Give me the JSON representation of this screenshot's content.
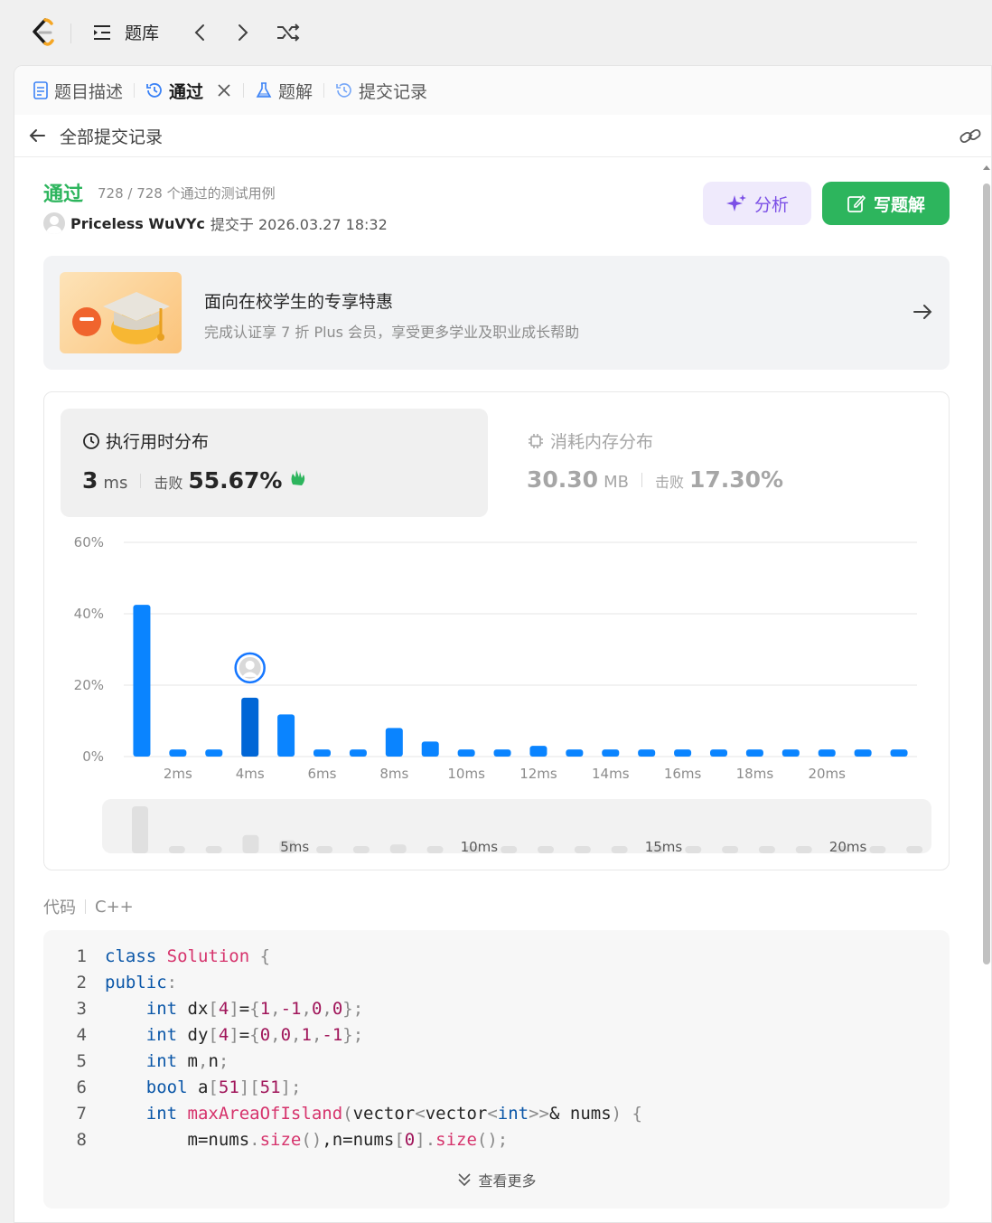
{
  "topbar": {
    "library_label": "题库"
  },
  "tabs": [
    {
      "label": "题目描述"
    },
    {
      "label": "通过"
    },
    {
      "label": "题解"
    },
    {
      "label": "提交记录"
    }
  ],
  "subhead": {
    "back_label": "全部提交记录"
  },
  "submission": {
    "status": "通过",
    "tests": "728 / 728 个通过的测试用例",
    "user": "Priceless WuVYc",
    "submitted_at": "提交于 2026.03.27 18:32"
  },
  "actions": {
    "analyze": "分析",
    "write_solution": "写题解"
  },
  "promo": {
    "title": "面向在校学生的专享特惠",
    "subtitle": "完成认证享 7 折 Plus 会员，享受更多学业及职业成长帮助"
  },
  "runtime": {
    "title": "执行用时分布",
    "value": "3",
    "unit": "ms",
    "beat_label": "击败",
    "beat_value": "55.67%"
  },
  "memory": {
    "title": "消耗内存分布",
    "value": "30.30",
    "unit": "MB",
    "beat_label": "击败",
    "beat_value": "17.30%"
  },
  "chart_data": {
    "type": "bar",
    "y_ticks": [
      "60%",
      "40%",
      "20%",
      "0%"
    ],
    "ylim": [
      0,
      60
    ],
    "categories": [
      1,
      2,
      3,
      4,
      5,
      6,
      7,
      8,
      9,
      10,
      11,
      12,
      13,
      14,
      15,
      16,
      17,
      18,
      19,
      20,
      21,
      22
    ],
    "values": [
      42.5,
      2,
      2,
      16.5,
      11.8,
      2,
      2,
      8,
      4.2,
      2,
      2,
      3,
      2,
      2,
      2,
      2,
      2,
      2,
      2,
      2,
      2,
      2
    ],
    "x_tick_labels": [
      {
        "at": 2,
        "label": "2ms"
      },
      {
        "at": 4,
        "label": "4ms"
      },
      {
        "at": 6,
        "label": "6ms"
      },
      {
        "at": 8,
        "label": "8ms"
      },
      {
        "at": 10,
        "label": "10ms"
      },
      {
        "at": 12,
        "label": "12ms"
      },
      {
        "at": 14,
        "label": "14ms"
      },
      {
        "at": 16,
        "label": "16ms"
      },
      {
        "at": 18,
        "label": "18ms"
      },
      {
        "at": 20,
        "label": "20ms"
      }
    ],
    "highlight_category": 4,
    "overview_labels": [
      {
        "at": 5,
        "label": "5ms"
      },
      {
        "at": 10,
        "label": "10ms"
      },
      {
        "at": 15,
        "label": "15ms"
      },
      {
        "at": 20,
        "label": "20ms"
      }
    ],
    "bar_color": "#0a84ff",
    "highlight_color": "#0066d6"
  },
  "code": {
    "label": "代码",
    "language": "C++",
    "line_numbers": [
      "1",
      "2",
      "3",
      "4",
      "5",
      "6",
      "7",
      "8"
    ],
    "see_more": "查看更多"
  },
  "colors": {
    "accent_green": "#2db55d",
    "accent_purple": "#7b4fe6"
  }
}
